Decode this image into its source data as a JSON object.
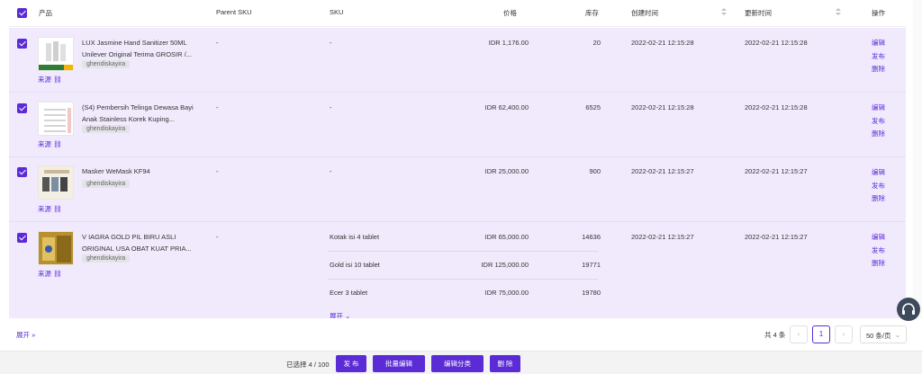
{
  "header": {
    "product": "产品",
    "parent_sku": "Parent SKU",
    "sku": "SKU",
    "price": "价格",
    "stock": "库存",
    "created": "创建时间",
    "updated": "更新时间",
    "actions": "操作"
  },
  "rows": [
    {
      "name": "LUX Jasmine Hand Sanitizer 50ML Unilever Original Terima GROSIR /...",
      "shop": "ghendiskayira",
      "source": "来源",
      "parent_sku": "-",
      "sku": "-",
      "price": "IDR 1,176.00",
      "stock": "20",
      "created": "2022-02-21 12:15:28",
      "updated": "2022-02-21 12:15:28",
      "edit": "编辑",
      "publish": "发布",
      "delete": "删除"
    },
    {
      "name": "(S4) Pembersih Telinga Dewasa Bayi Anak Stainless Korek Kuping...",
      "shop": "ghendiskayira",
      "source": "来源",
      "parent_sku": "-",
      "sku": "-",
      "price": "IDR 62,400.00",
      "stock": "6525",
      "created": "2022-02-21 12:15:28",
      "updated": "2022-02-21 12:15:28",
      "edit": "编辑",
      "publish": "发布",
      "delete": "删除"
    },
    {
      "name": "Masker WeMask KF94",
      "shop": "ghendiskayira",
      "source": "来源",
      "parent_sku": "-",
      "sku": "-",
      "price": "IDR 25,000.00",
      "stock": "900",
      "created": "2022-02-21 12:15:27",
      "updated": "2022-02-21 12:15:27",
      "edit": "编辑",
      "publish": "发布",
      "delete": "删除"
    },
    {
      "name": "V IAGRA GOLD PIL BIRU ASLI ORIGINAL USA OBAT KUAT PRIA...",
      "shop": "ghendiskayira",
      "source": "来源",
      "parent_sku": "-",
      "variants": [
        {
          "sku": "Kotak isi 4 tablet",
          "price": "IDR 65,000.00",
          "stock": "14636"
        },
        {
          "sku": "Gold isi 10 tablet",
          "price": "IDR 125,000.00",
          "stock": "19771"
        },
        {
          "sku": "Ecer 3 tablet",
          "price": "IDR 75,000.00",
          "stock": "19780"
        }
      ],
      "variant_expand": "展开",
      "created": "2022-02-21 12:15:27",
      "updated": "2022-02-21 12:15:27",
      "edit": "编辑",
      "publish": "发布",
      "delete": "删除"
    }
  ],
  "footer": {
    "expand": "展开",
    "total": "共 4 条",
    "prev": "‹",
    "page": "1",
    "next": "›",
    "page_size": "50 条/页"
  },
  "bottom_bar": {
    "selected": "已选择 4 / 100",
    "publish": "发 布",
    "batch_edit": "批量编辑",
    "edit_category": "编辑分类",
    "delete": "删 除"
  },
  "colors": {
    "accent": "#5b2bd6",
    "row_bg": "#f1eafd"
  }
}
